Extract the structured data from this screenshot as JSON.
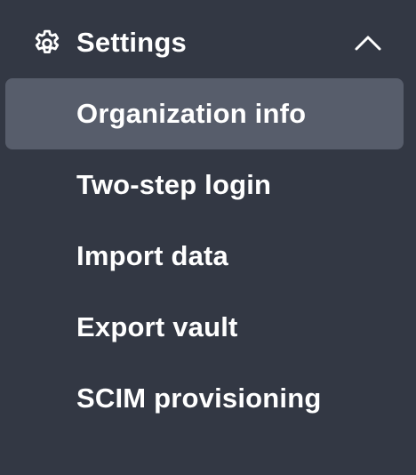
{
  "settings": {
    "title": "Settings",
    "icon": "gear-icon",
    "toggle_icon": "chevron-up-icon",
    "expanded": true,
    "items": [
      {
        "label": "Organization info",
        "active": true
      },
      {
        "label": "Two-step login",
        "active": false
      },
      {
        "label": "Import data",
        "active": false
      },
      {
        "label": "Export vault",
        "active": false
      },
      {
        "label": "SCIM provisioning",
        "active": false
      }
    ]
  },
  "colors": {
    "background": "#333844",
    "active_item": "#575d6b",
    "text": "#ffffff"
  }
}
